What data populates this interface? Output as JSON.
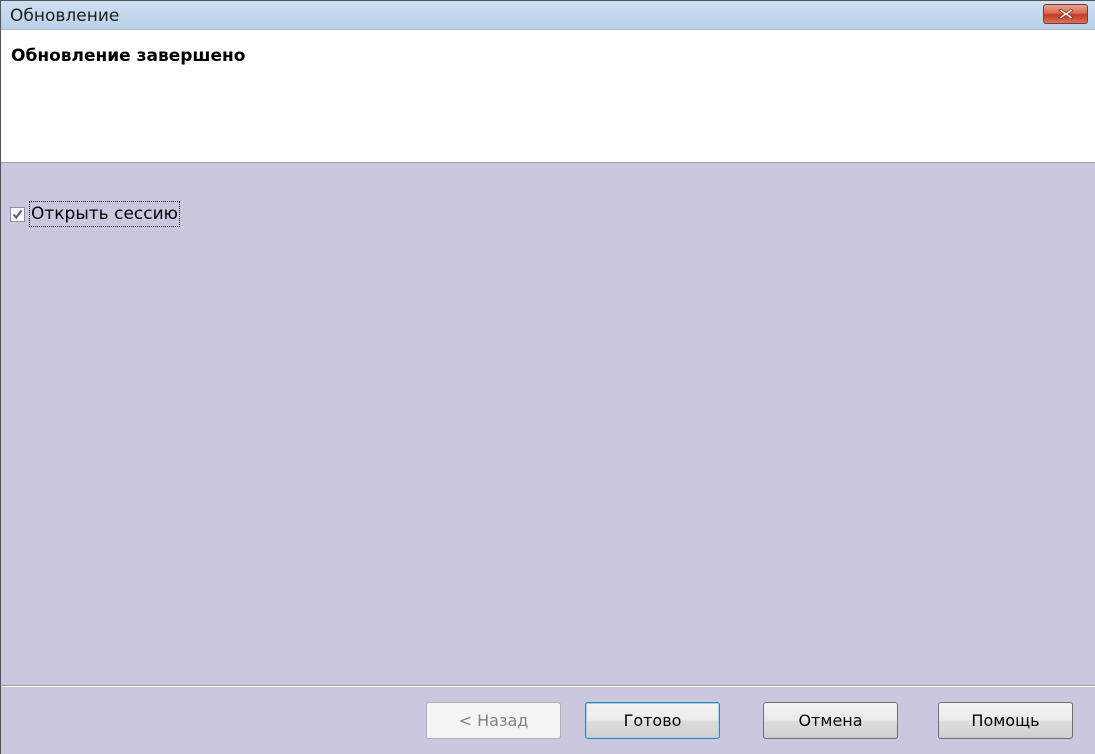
{
  "window": {
    "title": "Обновление",
    "close_icon": "close-icon"
  },
  "header": {
    "title": "Обновление завершено"
  },
  "options": {
    "open_session": {
      "label": "Открыть сессию",
      "checked": true
    }
  },
  "buttons": {
    "back": {
      "label": "< Назад",
      "enabled": false
    },
    "finish": {
      "label": "Готово",
      "enabled": true,
      "default": true
    },
    "cancel": {
      "label": "Отмена",
      "enabled": true
    },
    "help": {
      "label": "Помощь",
      "enabled": true
    }
  },
  "colors": {
    "body_background": "#cbc7de",
    "close_button": "#c23b21"
  }
}
